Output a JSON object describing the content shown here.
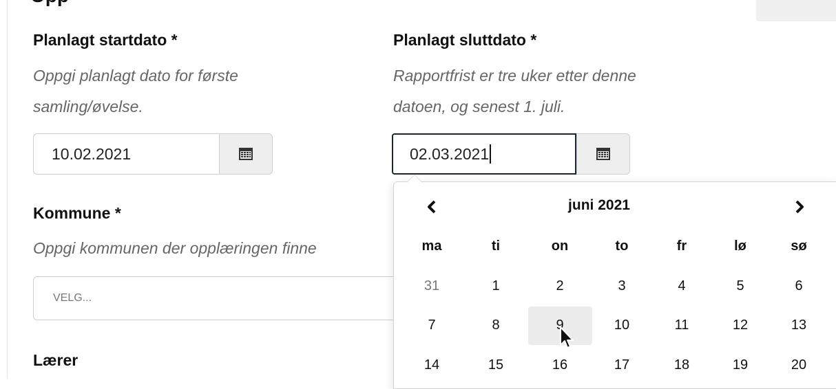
{
  "form": {
    "section_heading_partial": "Opp",
    "start_date": {
      "label": "Planlagt startdato *",
      "help_line1": "Oppgi planlagt dato for første",
      "help_line2": "samling/øvelse.",
      "value": "10.02.2021",
      "calendar_icon": "calendar-icon"
    },
    "end_date": {
      "label": "Planlagt sluttdato *",
      "help_line1": "Rapportfrist er tre uker etter denne",
      "help_line2": "datoen, og senest 1. juli.",
      "value": "02.03.2021",
      "calendar_icon": "calendar-icon"
    },
    "kommune": {
      "label": "Kommune *",
      "help": "Oppgi kommunen der opplæringen finne",
      "placeholder": "VELG..."
    },
    "teacher": {
      "label": "Lærer"
    }
  },
  "datepicker": {
    "month_title": "juni 2021",
    "prev_icon": "chevron-left-icon",
    "next_icon": "chevron-right-icon",
    "weekdays": [
      "ma",
      "ti",
      "on",
      "to",
      "fr",
      "lø",
      "sø"
    ],
    "weeks": [
      [
        "31",
        "1",
        "2",
        "3",
        "4",
        "5",
        "6"
      ],
      [
        "7",
        "8",
        "9",
        "10",
        "11",
        "12",
        "13"
      ],
      [
        "14",
        "15",
        "16",
        "17",
        "18",
        "19",
        "20"
      ]
    ],
    "hovered_day": "9",
    "cursor_icon": "mouse-pointer-icon"
  }
}
